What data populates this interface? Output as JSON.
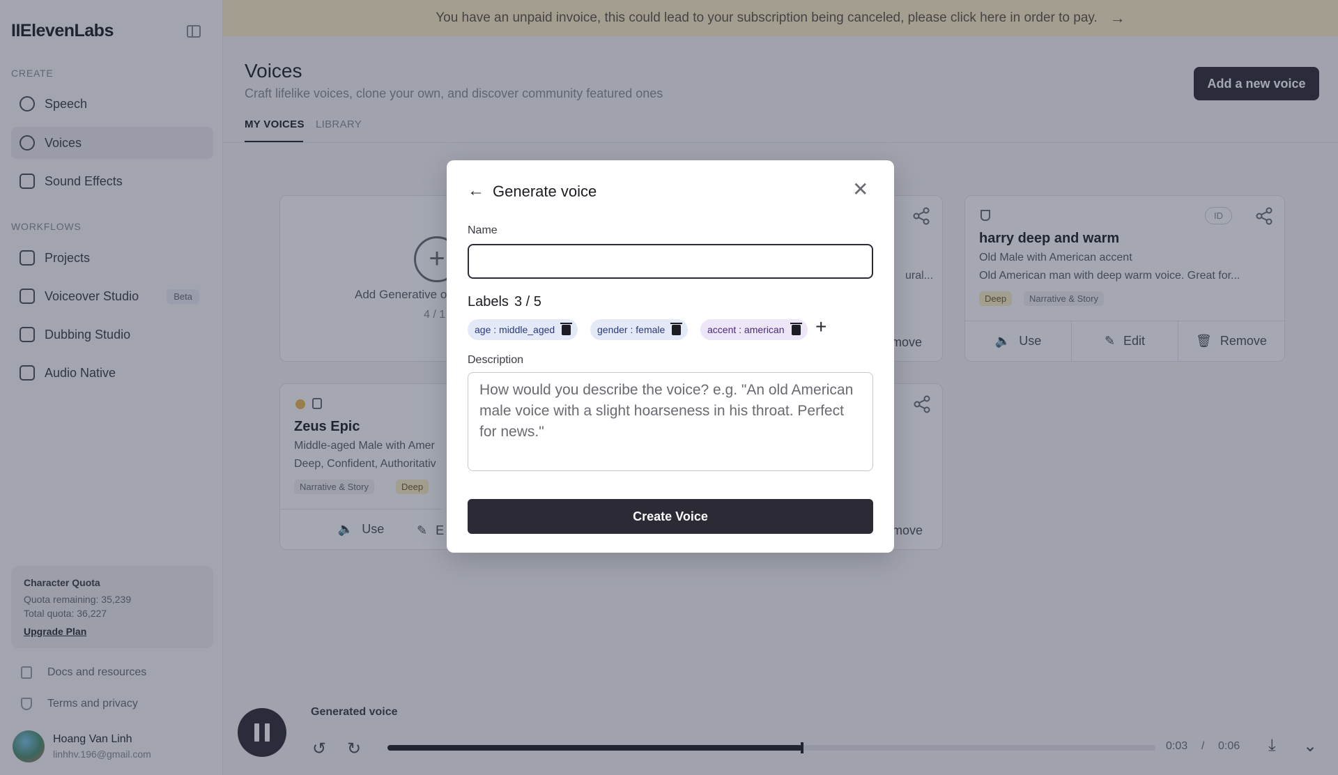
{
  "banner": {
    "text": "You have an unpaid invoice, this could lead to your subscription being canceled, please click here in order to pay.",
    "arrow": "→"
  },
  "sidebar": {
    "logo": "IIElevenLabs",
    "create_label": "CREATE",
    "workflows_label": "WORKFLOWS",
    "items": [
      {
        "label": "Speech"
      },
      {
        "label": "Voices"
      },
      {
        "label": "Sound Effects"
      },
      {
        "label": "Projects"
      },
      {
        "label": "Voiceover Studio",
        "badge": "Beta"
      },
      {
        "label": "Dubbing Studio"
      },
      {
        "label": "Audio Native"
      }
    ],
    "quota": {
      "title": "Character Quota",
      "remaining": "Quota remaining: 35,239",
      "total": "Total quota: 36,227",
      "upgrade": "Upgrade Plan"
    },
    "docs": "Docs and resources",
    "terms": "Terms and privacy",
    "user": {
      "name": "Hoang Van Linh",
      "email": "linhhv.196@gmail.com"
    }
  },
  "main": {
    "title": "Voices",
    "subtitle": "Craft lifelike voices, clone your own, and discover community featured ones",
    "add_voice": "Add a new voice",
    "tabs": [
      {
        "label": "MY VOICES"
      },
      {
        "label": "LIBRARY"
      }
    ]
  },
  "cards": {
    "add": {
      "label": "Add Generative o",
      "count": "4 / 1"
    },
    "partial_top": {
      "line": "ural...",
      "remove": "move"
    },
    "harry": {
      "id": "ID",
      "title": "harry deep and warm",
      "line1": "Old Male with American accent",
      "line2": "Old American man with deep warm voice. Great for...",
      "tags": [
        "Deep",
        "Narrative & Story"
      ],
      "use": "Use",
      "edit": "Edit",
      "remove": "Remove"
    },
    "zeus": {
      "title": "Zeus Epic",
      "line1": "Middle-aged Male with Amer",
      "line2": "Deep, Confident, Authoritativ",
      "tags": [
        "Narrative & Story",
        "Deep"
      ],
      "use": "Use",
      "edit": "E",
      "remove": "move"
    }
  },
  "player": {
    "title": "Generated voice",
    "current": "0:03",
    "separator": "/",
    "duration": "0:06",
    "progress": 0.54
  },
  "modal": {
    "title": "Generate voice",
    "name_label": "Name",
    "name_value": "",
    "labels_title": "Labels",
    "labels_count": "3 / 5",
    "labels": [
      {
        "text": "age : middle_aged",
        "color": "#e4e9f8"
      },
      {
        "text": "gender : female",
        "color": "#e4e9f8"
      },
      {
        "text": "accent : american",
        "color": "#ece6f8"
      }
    ],
    "add_label": "+",
    "description_label": "Description",
    "description_placeholder": "How would you describe the voice? e.g. \"An old American male voice with a slight hoarseness in his throat. Perfect for news.\"",
    "create_button": "Create Voice"
  }
}
